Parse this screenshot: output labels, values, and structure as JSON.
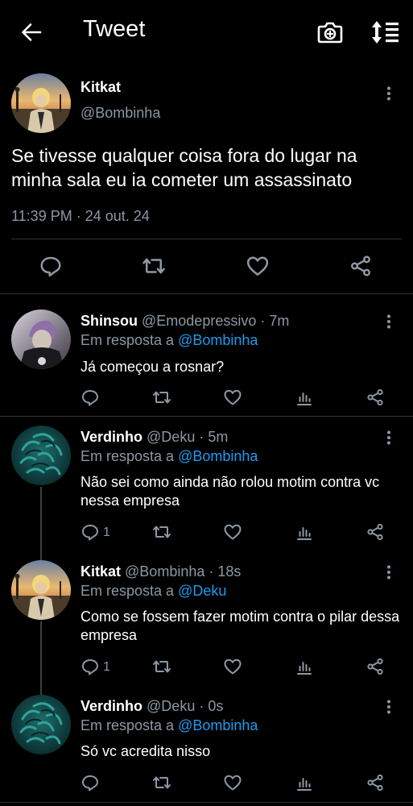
{
  "header": {
    "title": "Tweet"
  },
  "main_tweet": {
    "name": "Kitkat",
    "handle": "@Bombinha",
    "text": "Se tivesse qualquer coisa fora do lugar na minha sala eu ia cometer um assassinato",
    "timestamp": "11:39 PM · 24 out. 24"
  },
  "replies": [
    {
      "name": "Shinsou",
      "handle": "@Emodepressivo",
      "time": "· 7m",
      "reply_prefix": "Em resposta a",
      "reply_to": "@Bombinha",
      "text": "Já começou a rosnar?",
      "reply_count": ""
    },
    {
      "name": "Verdinho",
      "handle": "@Deku",
      "time": "· 5m",
      "reply_prefix": "Em resposta a",
      "reply_to": "@Bombinha",
      "text": "Não sei como ainda não rolou motim contra vc nessa empresa",
      "reply_count": "1"
    },
    {
      "name": "Kitkat",
      "handle": "@Bombinha",
      "time": "· 18s",
      "reply_prefix": "Em resposta a",
      "reply_to": "@Deku",
      "text": "Como se fossem fazer motim contra o pilar dessa empresa",
      "reply_count": "1"
    },
    {
      "name": "Verdinho",
      "handle": "@Deku",
      "time": "· 0s",
      "reply_prefix": "Em resposta a",
      "reply_to": "@Bombinha",
      "text": "Só vc acredita nisso",
      "reply_count": ""
    }
  ],
  "colors": {
    "background": "#000000",
    "mention": "#1d9bf0",
    "muted": "#8b98a5",
    "divider": "#2f3336"
  }
}
